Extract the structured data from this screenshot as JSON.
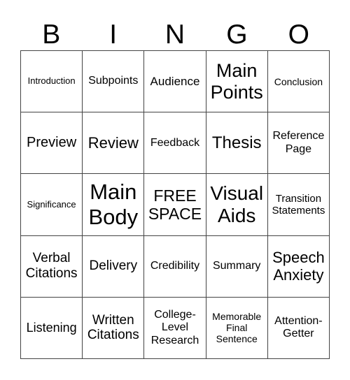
{
  "header": [
    "B",
    "I",
    "N",
    "G",
    "O"
  ],
  "cells": [
    [
      "Introduction",
      "Subpoints",
      "Audience",
      "Main Points",
      "Conclusion"
    ],
    [
      "Preview",
      "Review",
      "Feedback",
      "Thesis",
      "Reference Page"
    ],
    [
      "Significance",
      "Main Body",
      "FREE SPACE",
      "Visual Aids",
      "Transition Statements"
    ],
    [
      "Verbal Citations",
      "Delivery",
      "Credibility",
      "Summary",
      "Speech Anxiety"
    ],
    [
      "Listening",
      "Written Citations",
      "College-Level Research",
      "Memorable Final Sentence",
      "Attention-Getter"
    ]
  ]
}
